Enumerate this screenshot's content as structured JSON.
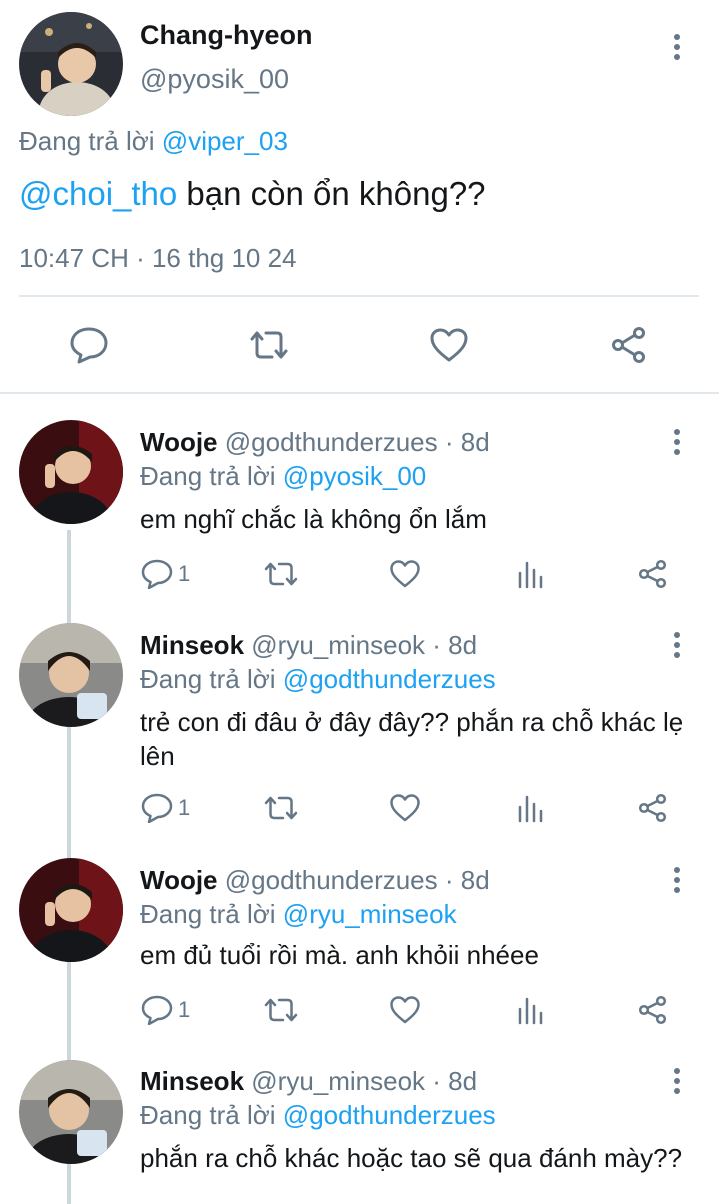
{
  "main_tweet": {
    "name": "Chang-hyeon",
    "handle": "@pyosik_00",
    "reply_prefix": "Đang trả lời",
    "reply_to": "@viper_03",
    "mention": "@choi_tho",
    "text": " bạn còn ổn không??",
    "time": "10:47 CH · 16 thg 10 24",
    "avatar_icon": "user-avatar"
  },
  "replies": [
    {
      "name": "Wooje",
      "handle": "@godthunderzues",
      "age": "· 8d",
      "reply_prefix": "Đang trả lời",
      "reply_to": "@pyosik_00",
      "text": "em nghĩ chắc là không ổn lắm",
      "reply_count": "1"
    },
    {
      "name": "Minseok",
      "handle": "@ryu_minseok",
      "age": "· 8d",
      "reply_prefix": "Đang trả lời",
      "reply_to": "@godthunderzues",
      "text": "trẻ con đi đâu ở đây đây?? phắn ra chỗ khác lẹ lên",
      "reply_count": "1"
    },
    {
      "name": "Wooje",
      "handle": "@godthunderzues",
      "age": "· 8d",
      "reply_prefix": "Đang trả lời",
      "reply_to": "@ryu_minseok",
      "text": "em đủ tuổi rồi mà. anh khỏii nhéee",
      "reply_count": "1"
    },
    {
      "name": "Minseok",
      "handle": "@ryu_minseok",
      "age": "· 8d",
      "reply_prefix": "Đang trả lời",
      "reply_to": "@godthunderzues",
      "text": "phắn ra chỗ khác hoặc tao sẽ qua đánh mày??",
      "reply_count": ""
    }
  ],
  "colors": {
    "link": "#1da1f2",
    "secondary_text": "#657786",
    "divider": "#e1e8ed"
  }
}
